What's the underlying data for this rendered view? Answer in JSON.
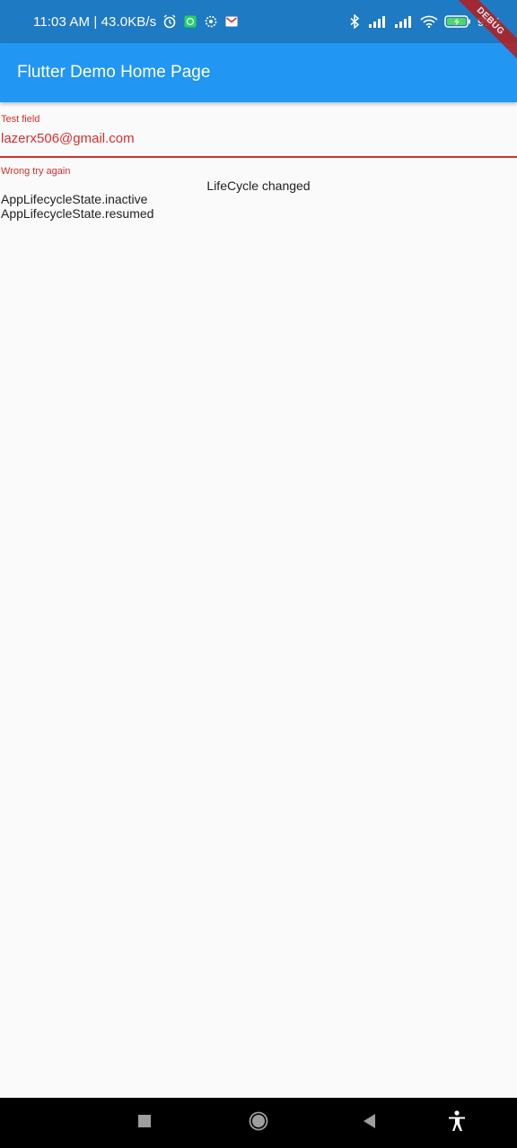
{
  "status_bar": {
    "time": "11:03 AM | 43.0KB/s",
    "battery": "99%",
    "left_icons": [
      "alarm-icon",
      "whatsapp-icon",
      "settings-icon",
      "gmail-icon"
    ],
    "right_icons": [
      "bluetooth-icon",
      "signal-icon",
      "signal-icon",
      "wifi-icon",
      "battery-icon"
    ]
  },
  "app_bar": {
    "title": "Flutter Demo Home Page"
  },
  "debug_banner": {
    "label": "DEBUG"
  },
  "text_field": {
    "label": "Test field",
    "value": "lazerx506@gmail.com",
    "error": "Wrong try again"
  },
  "lifecycle": {
    "title": "LifeCycle changed",
    "items": [
      "AppLifecycleState.inactive",
      "AppLifecycleState.resumed"
    ]
  },
  "colors": {
    "status_bar": "#1f7ac4",
    "app_bar": "#2196f3",
    "error": "#d32f2f",
    "nav_bar": "#000000"
  },
  "nav_bar": {
    "buttons": [
      "recents-icon",
      "home-icon",
      "back-icon",
      "accessibility-icon"
    ]
  }
}
